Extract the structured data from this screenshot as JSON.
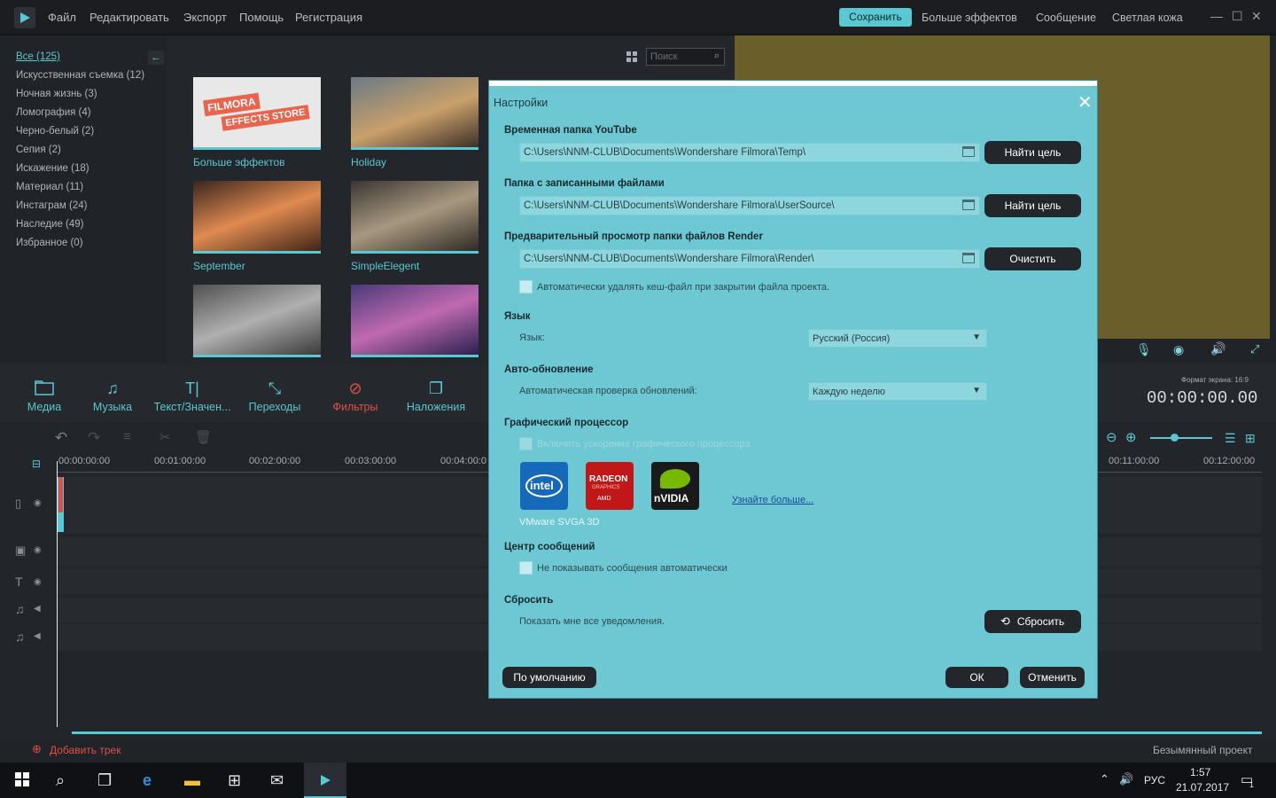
{
  "menu": {
    "file": "Файл",
    "edit": "Редактировать",
    "export": "Экспорт",
    "help": "Помощь",
    "register": "Регистрация"
  },
  "top_right": {
    "save": "Сохранить",
    "more_effects": "Больше эффектов",
    "message": "Сообщение",
    "skin": "Светлая кожа"
  },
  "categories": [
    {
      "label": "Все (125)"
    },
    {
      "label": "Искусственная съемка (12)"
    },
    {
      "label": "Ночная жизнь (3)"
    },
    {
      "label": "Ломография (4)"
    },
    {
      "label": "Черно-белый (2)"
    },
    {
      "label": "Сепия (2)"
    },
    {
      "label": "Искажение (18)"
    },
    {
      "label": "Материал (11)"
    },
    {
      "label": "Инстаграм (24)"
    },
    {
      "label": "Наследие (49)"
    },
    {
      "label": "Избранное (0)"
    }
  ],
  "search": {
    "placeholder": "Поиск"
  },
  "thumbs": [
    {
      "label": "Больше эффектов",
      "logo_line1": "FILMORA",
      "logo_line2": "EFFECTS STORE"
    },
    {
      "label": "Holiday"
    },
    {
      "label": "September"
    },
    {
      "label": "SimpleElegent"
    },
    {
      "label": ""
    },
    {
      "label": ""
    }
  ],
  "tools": [
    {
      "label": "Медиа",
      "icon": "folder-icon"
    },
    {
      "label": "Музыка",
      "icon": "music-icon"
    },
    {
      "label": "Текст/Значен...",
      "icon": "text-icon"
    },
    {
      "label": "Переходы",
      "icon": "transition-icon"
    },
    {
      "label": "Фильтры",
      "icon": "filter-icon"
    },
    {
      "label": "Наложения",
      "icon": "overlay-icon"
    }
  ],
  "preview": {
    "aspect": "Формат экрана: 16:9",
    "timecode": "00:00:00.00"
  },
  "ruler": [
    "00:00:00:00",
    "00:01:00:00",
    "00:02:00:00",
    "00:03:00:00",
    "00:04:00:0",
    "00:11:00:00",
    "00:12:00:00"
  ],
  "status": {
    "add_track": "Добавить трек",
    "project": "Безымянный проект"
  },
  "taskbar": {
    "lang": "РУС",
    "time": "1:57",
    "date": "21.07.2017",
    "notif": "1"
  },
  "dialog": {
    "title": "Настройки",
    "youtube_title": "Временная папка YouTube",
    "youtube_path": "C:\\Users\\NNM-CLUB\\Documents\\Wondershare Filmora\\Temp\\",
    "find_btn": "Найти цель",
    "rec_title": "Папка с записанными файлами",
    "rec_path": "C:\\Users\\NNM-CLUB\\Documents\\Wondershare Filmora\\UserSource\\",
    "render_title": "Предварительный просмотр папки файлов Render",
    "render_path": "C:\\Users\\NNM-CLUB\\Documents\\Wondershare Filmora\\Render\\",
    "clear_btn": "Очистить",
    "auto_delete": "Автоматически удалять кеш-файл при закрытии файла проекта.",
    "lang_title": "Язык",
    "lang_label": "Язык:",
    "lang_value": "Русский (Россия)",
    "update_title": "Авто-обновление",
    "update_label": "Автоматическая проверка обновлений:",
    "update_value": "Каждую неделю",
    "gpu_title": "Графический процессор",
    "gpu_enable": "Включить ускорение графического процессора",
    "gpu_name": "VMware SVGA 3D",
    "gpu_learn": "Узнайте больше...",
    "msg_title": "Центр сообщений",
    "msg_label": "Не показывать сообщения автоматически",
    "reset_title": "Сбросить",
    "reset_label": "Показать мне все уведомления.",
    "reset_btn": "Сбросить",
    "default_btn": "По умолчанию",
    "ok_btn": "ОК",
    "cancel_btn": "Отменить"
  },
  "colors": {
    "accent": "#5ac8d2",
    "dialog_bg": "#6ec8d3",
    "preview_bg": "#6a5e2a",
    "filter_active": "#e0504a"
  }
}
